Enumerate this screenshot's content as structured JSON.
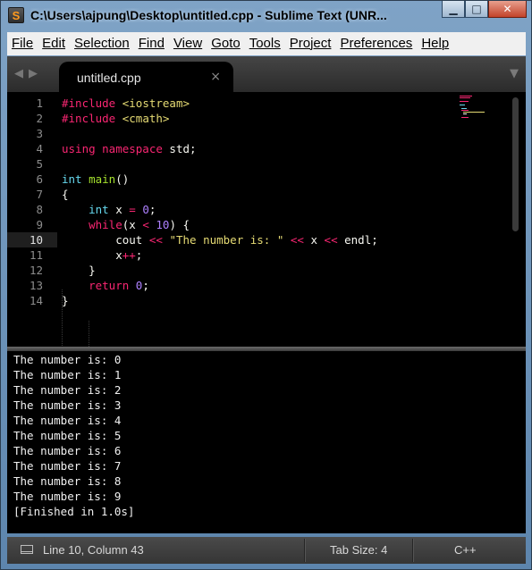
{
  "window": {
    "title": "C:\\Users\\ajpung\\Desktop\\untitled.cpp - Sublime Text (UNR...",
    "app_icon": "S",
    "minimize_glyph": "▁",
    "maximize_glyph": "□",
    "close_glyph": "✕"
  },
  "menu": [
    "File",
    "Edit",
    "Selection",
    "Find",
    "View",
    "Goto",
    "Tools",
    "Project",
    "Preferences",
    "Help"
  ],
  "tabs": {
    "nav_glyphs": "◀▶",
    "active_tab": "untitled.cpp",
    "close_glyph": "×",
    "dropdown_glyph": "▼"
  },
  "editor": {
    "line_numbers": [
      "1",
      "2",
      "3",
      "4",
      "5",
      "6",
      "7",
      "8",
      "9",
      "10",
      "11",
      "12",
      "13",
      "14"
    ],
    "current_line": 10,
    "code_lines": [
      [
        {
          "t": "#include",
          "c": "pp"
        },
        {
          "t": " "
        },
        {
          "t": "<iostream>",
          "c": "inc"
        }
      ],
      [
        {
          "t": "#include",
          "c": "pp"
        },
        {
          "t": " "
        },
        {
          "t": "<cmath>",
          "c": "inc"
        }
      ],
      [],
      [
        {
          "t": "using namespace",
          "c": "kw"
        },
        {
          "t": " std;"
        }
      ],
      [],
      [
        {
          "t": "int",
          "c": "type"
        },
        {
          "t": " "
        },
        {
          "t": "main",
          "c": "fn"
        },
        {
          "t": "()"
        }
      ],
      [
        {
          "t": "{"
        }
      ],
      [
        {
          "t": "    "
        },
        {
          "t": "int",
          "c": "type"
        },
        {
          "t": " x "
        },
        {
          "t": "=",
          "c": "op"
        },
        {
          "t": " "
        },
        {
          "t": "0",
          "c": "num"
        },
        {
          "t": ";"
        }
      ],
      [
        {
          "t": "    "
        },
        {
          "t": "while",
          "c": "kw"
        },
        {
          "t": "(x "
        },
        {
          "t": "<",
          "c": "op"
        },
        {
          "t": " "
        },
        {
          "t": "10",
          "c": "num"
        },
        {
          "t": ") {"
        }
      ],
      [
        {
          "t": "        cout "
        },
        {
          "t": "<<",
          "c": "op"
        },
        {
          "t": " "
        },
        {
          "t": "\"The number is: \"",
          "c": "str"
        },
        {
          "t": " "
        },
        {
          "t": "<<",
          "c": "op"
        },
        {
          "t": " x "
        },
        {
          "t": "<<",
          "c": "op"
        },
        {
          "t": " endl;"
        }
      ],
      [
        {
          "t": "        x"
        },
        {
          "t": "++",
          "c": "op"
        },
        {
          "t": ";"
        }
      ],
      [
        {
          "t": "    }"
        }
      ],
      [
        {
          "t": "    "
        },
        {
          "t": "return",
          "c": "kw"
        },
        {
          "t": " "
        },
        {
          "t": "0",
          "c": "num"
        },
        {
          "t": ";"
        }
      ],
      [
        {
          "t": "}"
        }
      ]
    ]
  },
  "output": {
    "lines": [
      "The number is: 0",
      "The number is: 1",
      "The number is: 2",
      "The number is: 3",
      "The number is: 4",
      "The number is: 5",
      "The number is: 6",
      "The number is: 7",
      "The number is: 8",
      "The number is: 9",
      "[Finished in 1.0s]"
    ]
  },
  "status": {
    "position": "Line 10, Column 43",
    "tab_size": "Tab Size: 4",
    "syntax": "C++"
  },
  "colors": {
    "keyword": "#f92672",
    "type": "#66d9ef",
    "function": "#a6e22e",
    "number": "#ae81ff",
    "string": "#e6db74",
    "background": "#000000"
  }
}
